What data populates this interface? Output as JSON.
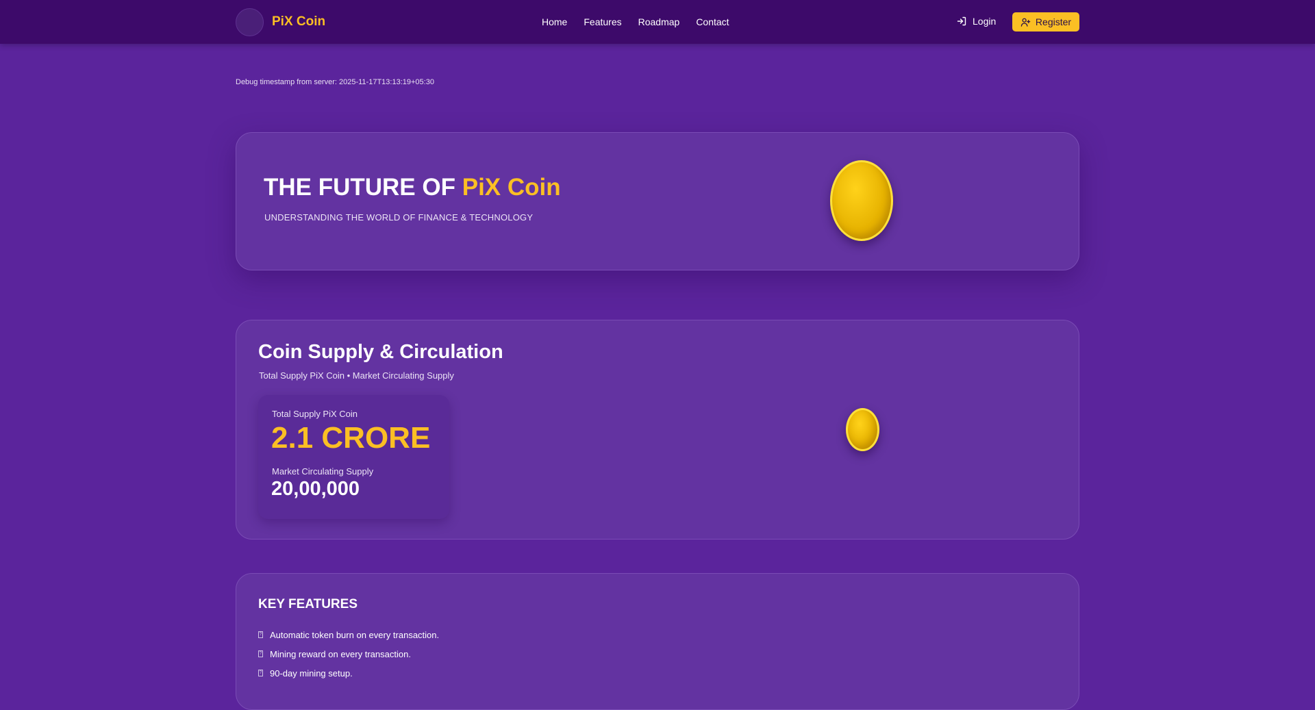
{
  "nav": {
    "brand": "PiX Coin",
    "links": [
      "Home",
      "Features",
      "Roadmap",
      "Contact"
    ],
    "login_label": "Login",
    "register_label": "Register",
    "login_icon": "login-icon",
    "register_icon": "user-plus-icon"
  },
  "debug": "Debug timestamp from server: 2025-11-17T13:13:19+05:30",
  "hero": {
    "title_prefix": "THE FUTURE OF ",
    "title_accent": "PiX Coin",
    "subtitle": "UNDERSTANDING THE WORLD OF FINANCE & TECHNOLOGY"
  },
  "supply": {
    "title": "Coin Supply & Circulation",
    "subtitle": "Total Supply PiX Coin • Market Circulating Supply",
    "total_label": "Total Supply PiX Coin",
    "total_value": "2.1 CRORE",
    "circulating_label": "Market Circulating Supply",
    "circulating_value": "20,00,000"
  },
  "features": {
    "title": "KEY FEATURES",
    "items": [
      "Automatic token burn on every transaction.",
      "Mining reward on every transaction.",
      "90-day mining setup."
    ]
  },
  "colors": {
    "accent": "#fbbf24",
    "nav_bg": "#3d0a6a",
    "page_bg": "#5b249c",
    "card_bg": "#6333a1"
  }
}
